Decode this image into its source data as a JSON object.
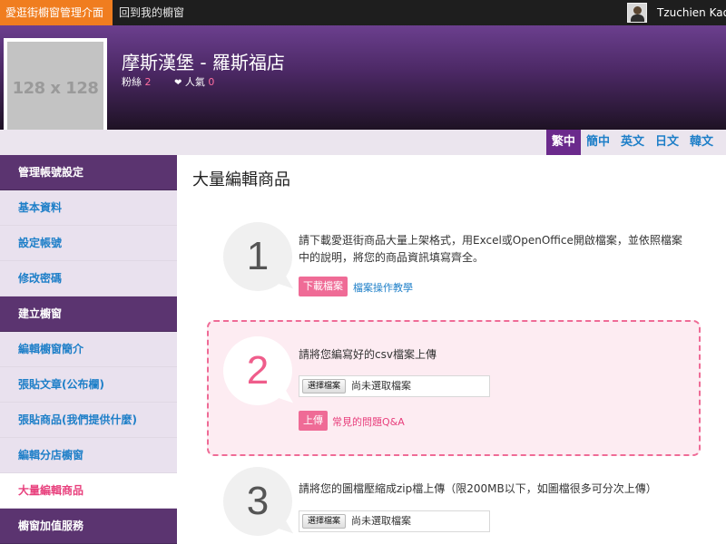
{
  "topbar": {
    "brand": "愛逛街櫥窗管理介面",
    "back_link": "回到我的櫥窗",
    "user_name": "Tzuchien Kao"
  },
  "banner": {
    "logo_placeholder": "128 x 128",
    "store_name": "摩斯漢堡 - 羅斯福店",
    "fans_label": "粉絲",
    "fans_count": "2",
    "popularity_label": "人氣",
    "popularity_count": "0"
  },
  "languages": [
    {
      "label": "繁中",
      "active": true
    },
    {
      "label": "簡中",
      "active": false
    },
    {
      "label": "英文",
      "active": false
    },
    {
      "label": "日文",
      "active": false
    },
    {
      "label": "韓文",
      "active": false
    }
  ],
  "sidebar": {
    "items": [
      {
        "label": "管理帳號設定",
        "type": "head"
      },
      {
        "label": "基本資料",
        "type": "link"
      },
      {
        "label": "設定帳號",
        "type": "link"
      },
      {
        "label": "修改密碼",
        "type": "link"
      },
      {
        "label": "建立櫥窗",
        "type": "head"
      },
      {
        "label": "編輯櫥窗簡介",
        "type": "link"
      },
      {
        "label": "張貼文章(公布欄)",
        "type": "link"
      },
      {
        "label": "張貼商品(我們提供什麼)",
        "type": "link"
      },
      {
        "label": "編輯分店櫥窗",
        "type": "link"
      },
      {
        "label": "大量編輯商品",
        "type": "active"
      },
      {
        "label": "櫥窗加值服務",
        "type": "head"
      }
    ]
  },
  "main": {
    "title": "大量編輯商品",
    "step1": {
      "number": "1",
      "text_line1": "請下載愛逛街商品大量上架格式，用Excel或OpenOffice開啟檔案，並依照檔案",
      "text_line2": "中的說明，將您的商品資訊填寫齊全。",
      "download_button": "下載檔案",
      "tutorial_link": "檔案操作教學"
    },
    "step2": {
      "number": "2",
      "text": "請將您編寫好的csv檔案上傳",
      "file_button": "選擇檔案",
      "file_status": "尚未選取檔案",
      "upload_button": "上傳",
      "faq_link": "常見的問題Q&A"
    },
    "step3": {
      "number": "3",
      "text": "請將您的圖檔壓縮成zip檔上傳（限200MB以下，如圖檔很多可分次上傳）",
      "file_button": "選擇檔案",
      "file_status": "尚未選取檔案"
    }
  }
}
